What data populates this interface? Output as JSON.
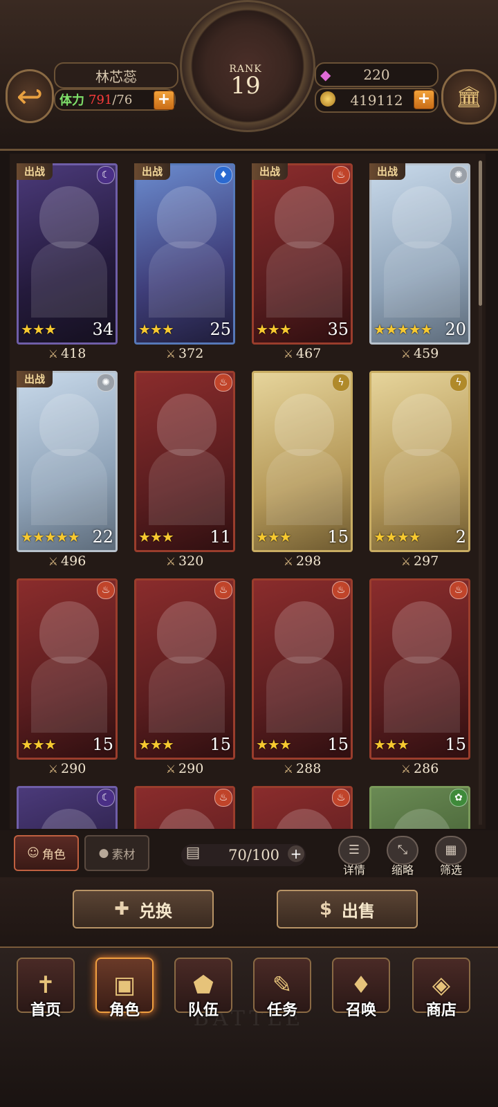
{
  "header": {
    "player_name": "林芯蕊",
    "stamina_label": "体力",
    "stamina_current": "791",
    "stamina_max": "/76",
    "rank_label": "RANK",
    "rank_value": "19",
    "gems": "220",
    "gold": "419112"
  },
  "characters": [
    {
      "deployed": "出战",
      "element": "dark",
      "stars": "★★★",
      "level": "34",
      "power": "418"
    },
    {
      "deployed": "出战",
      "element": "water",
      "stars": "★★★",
      "level": "25",
      "power": "372"
    },
    {
      "deployed": "出战",
      "element": "fire",
      "stars": "★★★",
      "level": "35",
      "power": "467"
    },
    {
      "deployed": "出战",
      "element": "light",
      "stars": "★★★★★",
      "level": "20",
      "power": "459"
    },
    {
      "deployed": "出战",
      "element": "light",
      "stars": "★★★★★",
      "level": "22",
      "power": "496"
    },
    {
      "deployed": "",
      "element": "fire",
      "stars": "★★★",
      "level": "11",
      "power": "320"
    },
    {
      "deployed": "",
      "element": "thunder",
      "stars": "★★★",
      "level": "15",
      "power": "298"
    },
    {
      "deployed": "",
      "element": "thunder",
      "stars": "★★★★",
      "level": "2",
      "power": "297"
    },
    {
      "deployed": "",
      "element": "fire",
      "stars": "★★★",
      "level": "15",
      "power": "290"
    },
    {
      "deployed": "",
      "element": "fire",
      "stars": "★★★",
      "level": "15",
      "power": "290"
    },
    {
      "deployed": "",
      "element": "fire",
      "stars": "★★★",
      "level": "15",
      "power": "288"
    },
    {
      "deployed": "",
      "element": "fire",
      "stars": "★★★",
      "level": "15",
      "power": "286"
    },
    {
      "deployed": "",
      "element": "dark",
      "stars": "",
      "level": "",
      "power": ""
    },
    {
      "deployed": "",
      "element": "fire",
      "stars": "",
      "level": "",
      "power": ""
    },
    {
      "deployed": "",
      "element": "fire",
      "stars": "",
      "level": "",
      "power": ""
    },
    {
      "deployed": "",
      "element": "earth",
      "stars": "",
      "level": "",
      "power": ""
    }
  ],
  "controls": {
    "tab_role": "角色",
    "tab_material": "素材",
    "capacity": "70/100",
    "details": "详情",
    "compact": "缩略",
    "filter": "筛选"
  },
  "actions": {
    "exchange": "兑换",
    "sell": "出售"
  },
  "nav": {
    "home": "首页",
    "role": "角色",
    "team": "队伍",
    "quest": "任务",
    "summon": "召唤",
    "shop": "商店"
  },
  "watermark": "BATTLE",
  "colors": {
    "accent": "#f0a040",
    "stamina_over": "#ff3c3c",
    "stamina_label": "#7ee06a",
    "stars": "#f7c930"
  }
}
